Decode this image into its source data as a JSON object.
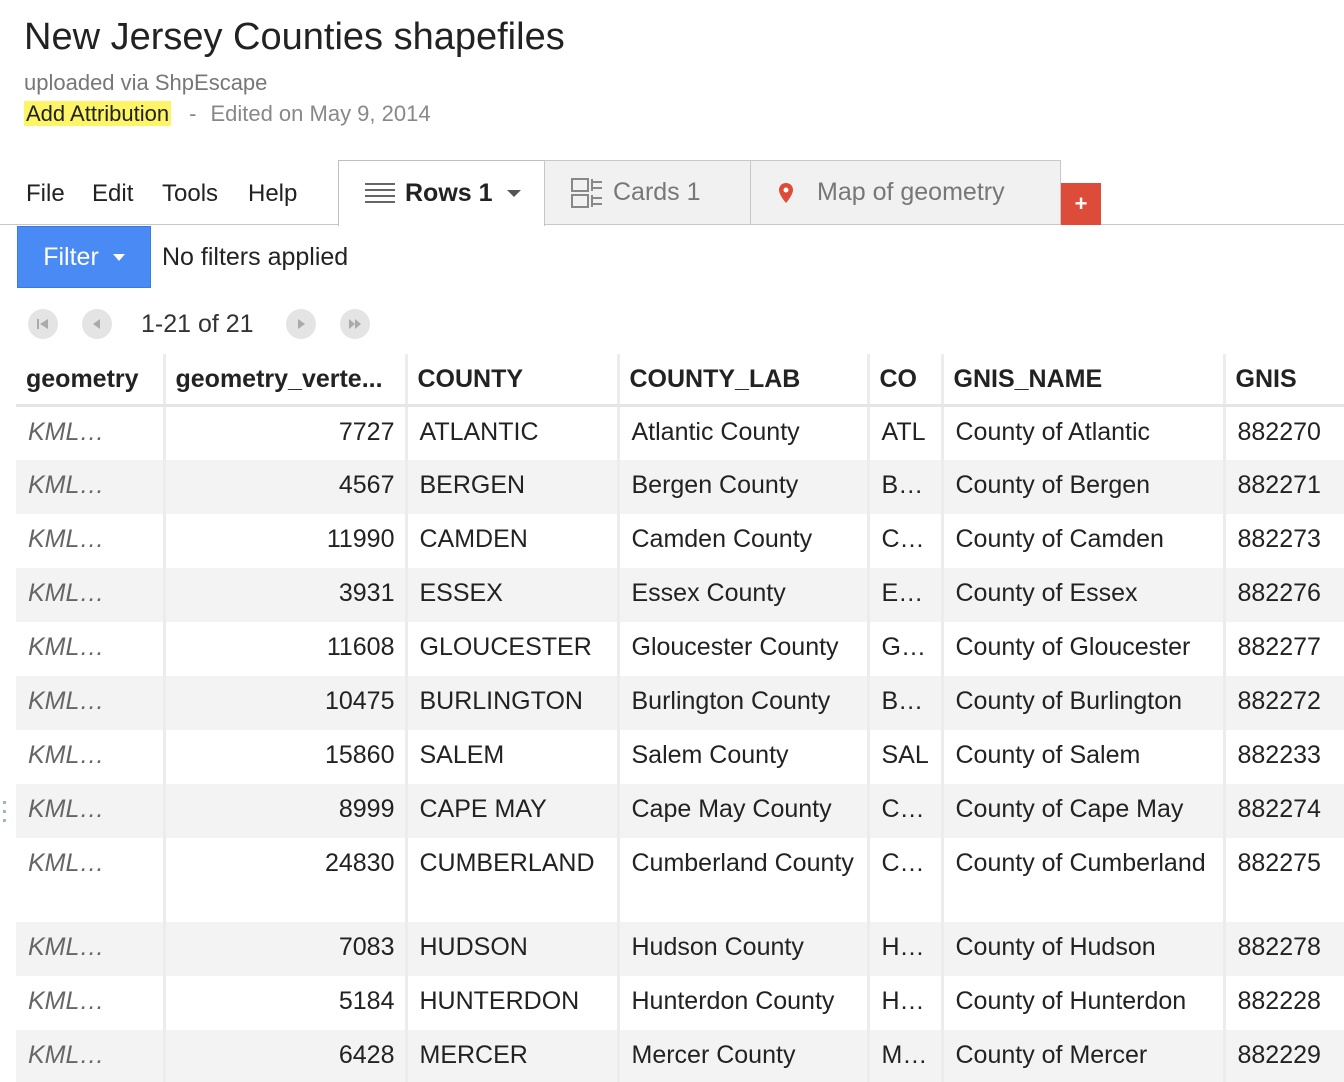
{
  "header": {
    "title": "New Jersey Counties shapefiles",
    "subtitle": "uploaded via ShpEscape",
    "add_attribution": "Add Attribution",
    "separator": "-",
    "edited": "Edited on May 9, 2014"
  },
  "menu": {
    "file": "File",
    "edit": "Edit",
    "tools": "Tools",
    "help": "Help"
  },
  "tabs": {
    "rows": "Rows 1",
    "cards": "Cards 1",
    "map": "Map of geometry",
    "add": "+"
  },
  "filter": {
    "button": "Filter",
    "status": "No filters applied"
  },
  "pager": {
    "range": "1-21 of 21"
  },
  "table": {
    "columns": [
      "geometry",
      "geometry_verte...",
      "COUNTY",
      "COUNTY_LAB",
      "CO",
      "GNIS_NAME",
      "GNIS"
    ],
    "rows": [
      [
        "KML…",
        "7727",
        "ATLANTIC",
        "Atlantic County",
        "ATL",
        "County of Atlantic",
        "882270"
      ],
      [
        "KML…",
        "4567",
        "BERGEN",
        "Bergen County",
        "BER",
        "County of Bergen",
        "882271"
      ],
      [
        "KML…",
        "11990",
        "CAMDEN",
        "Camden County",
        "C…",
        "County of Camden",
        "882273"
      ],
      [
        "KML…",
        "3931",
        "ESSEX",
        "Essex County",
        "ESS",
        "County of Essex",
        "882276"
      ],
      [
        "KML…",
        "11608",
        "GLOUCESTER",
        "Gloucester County",
        "G…",
        "County of Gloucester",
        "882277"
      ],
      [
        "KML…",
        "10475",
        "BURLINGTON",
        "Burlington County",
        "B…",
        "County of Burlington",
        "882272"
      ],
      [
        "KML…",
        "15860",
        "SALEM",
        "Salem County",
        "SAL",
        "County of Salem",
        "882233"
      ],
      [
        "KML…",
        "8999",
        "CAPE MAY",
        "Cape May County",
        "CAP",
        "County of Cape May",
        "882274"
      ],
      [
        "KML…",
        "24830",
        "CUMBERLAND",
        "Cumberland County",
        "C…",
        "County of Cumberland",
        "882275"
      ],
      [
        "KML…",
        "7083",
        "HUDSON",
        "Hudson County",
        "H…",
        "County of Hudson",
        "882278"
      ],
      [
        "KML…",
        "5184",
        "HUNTERDON",
        "Hunterdon County",
        "H…",
        "County of Hunterdon",
        "882228"
      ],
      [
        "KML…",
        "6428",
        "MERCER",
        "Mercer County",
        "M…",
        "County of Mercer",
        "882229"
      ]
    ]
  },
  "colors": {
    "filter_button": "#4a8af4",
    "add_tab": "#dd4b39",
    "highlight": "#fdf466",
    "map_pin": "#dd4b39"
  },
  "icons": {
    "rows_tab": "rows-list-icon",
    "cards_tab": "cards-grid-icon",
    "map_tab": "map-pin-icon"
  }
}
